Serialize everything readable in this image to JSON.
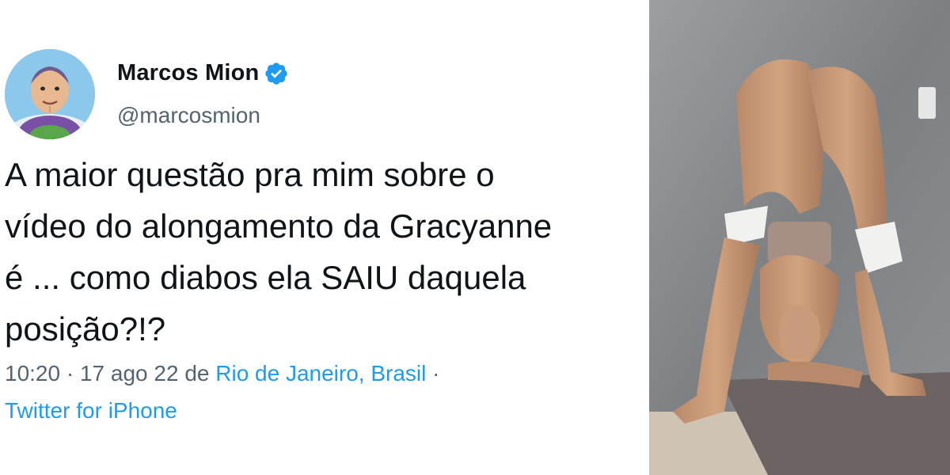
{
  "tweet": {
    "display_name": "Marcos Mion",
    "handle": "@marcosmion",
    "verified_icon": "verified-badge-icon",
    "text": "A maior questão pra mim sobre o\nvídeo do alongamento da Gracyanne\né ... como diabos ela SAIU daquela\nposição?!?",
    "time": "10:20",
    "separator": " · ",
    "date": "17 ago 22",
    "from_prefix": " de ",
    "location": "Rio de Janeiro, Brasil",
    "trailing_separator": " ·",
    "source": "Twitter for iPhone"
  },
  "colors": {
    "text": "#0f1419",
    "secondary": "#536471",
    "link": "#1d9bf0",
    "verified": "#1d9bf0"
  }
}
